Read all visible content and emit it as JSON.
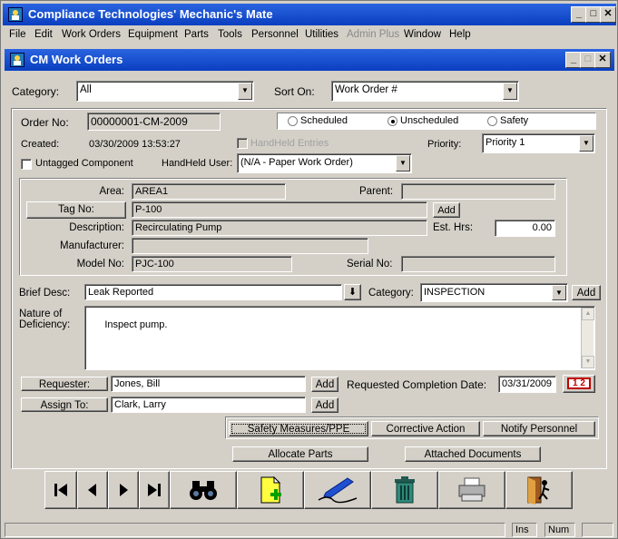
{
  "app": {
    "title": "Compliance Technologies' Mechanic's Mate"
  },
  "menu": [
    "File",
    "Edit",
    "Work Orders",
    "Equipment",
    "Parts",
    "Tools",
    "Personnel",
    "Utilities",
    "Admin Plus",
    "Window",
    "Help"
  ],
  "child_window": {
    "title": "CM Work Orders"
  },
  "filter": {
    "category_label": "Category:",
    "category_value": "All",
    "sort_label": "Sort On:",
    "sort_value": "Work Order #"
  },
  "order": {
    "order_no_label": "Order No:",
    "order_no": "00000001-CM-2009",
    "created_label": "Created:",
    "created": "03/30/2009  13:53:27",
    "handheld_entries_label": "HandHeld Entries",
    "untagged_label": "Untagged Component",
    "handheld_user_label": "HandHeld User:",
    "handheld_user": "(N/A - Paper Work Order)",
    "priority_label": "Priority:",
    "priority": "Priority 1"
  },
  "schedule": {
    "scheduled": "Scheduled",
    "unscheduled": "Unscheduled",
    "safety": "Safety"
  },
  "equipment": {
    "area_label": "Area:",
    "area": "AREA1",
    "parent_label": "Parent:",
    "parent": "",
    "tag_button": "Tag No:",
    "tag": "P-100",
    "add_label": "Add",
    "description_label": "Description:",
    "description": "Recirculating Pump",
    "est_hrs_label": "Est. Hrs:",
    "est_hrs": "0.00",
    "manufacturer_label": "Manufacturer:",
    "manufacturer": "",
    "model_label": "Model No:",
    "model": "PJC-100",
    "serial_label": "Serial No:",
    "serial": ""
  },
  "brief": {
    "label": "Brief Desc:",
    "value": "Leak Reported",
    "category_label": "Category:",
    "category_value": "INSPECTION",
    "add_label": "Add"
  },
  "nature": {
    "label_line1": "Nature of",
    "label_line2": "Deficiency:",
    "value": "Inspect pump."
  },
  "requester": {
    "button": "Requester:",
    "value": "Jones, Bill",
    "add_label": "Add",
    "completion_label": "Requested Completion Date:",
    "completion_date": "03/31/2009",
    "calendar_label": "1 2"
  },
  "assign": {
    "button": "Assign To:",
    "value": "Clark, Larry",
    "add_label": "Add"
  },
  "actions": {
    "safety": "Safety Measures/PPE",
    "corrective": "Corrective Action",
    "notify": "Notify Personnel",
    "allocate": "Allocate Parts",
    "attached": "Attached Documents"
  },
  "toolbar": [
    "first-record-icon",
    "previous-record-icon",
    "next-record-icon",
    "last-record-icon",
    "binoculars-icon",
    "new-record-icon",
    "edit-pen-icon",
    "trash-icon",
    "printer-icon",
    "exit-icon"
  ],
  "status": {
    "ins": "Ins",
    "num": "Num"
  },
  "colors": {
    "titlebar": "#0a3fc0",
    "face": "#d4d0c8"
  }
}
